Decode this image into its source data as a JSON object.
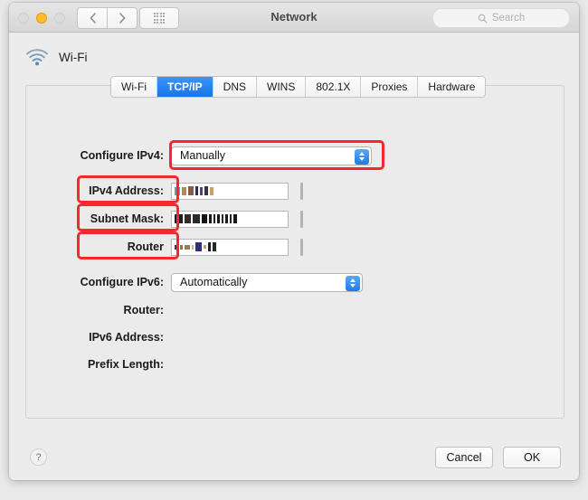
{
  "window": {
    "title": "Network",
    "traffic_lights": [
      "close-button",
      "minimize-button",
      "zoom-button"
    ],
    "nav_back": "‹",
    "nav_forward": "›",
    "grid_button": "show-all-button"
  },
  "search": {
    "placeholder": "Search",
    "icon": "search-icon"
  },
  "service": {
    "name": "Wi-Fi",
    "icon": "wifi-icon"
  },
  "tabs": [
    {
      "label": "Wi-Fi",
      "active": false
    },
    {
      "label": "TCP/IP",
      "active": true
    },
    {
      "label": "DNS",
      "active": false
    },
    {
      "label": "WINS",
      "active": false
    },
    {
      "label": "802.1X",
      "active": false
    },
    {
      "label": "Proxies",
      "active": false
    },
    {
      "label": "Hardware",
      "active": false
    }
  ],
  "form": {
    "configure_ipv4": {
      "label": "Configure IPv4:",
      "value": "Manually",
      "annotated": true
    },
    "ipv4_address": {
      "label": "IPv4 Address:",
      "value": "",
      "redacted": true,
      "annotated": true
    },
    "subnet_mask": {
      "label": "Subnet Mask:",
      "value": "",
      "redacted": true,
      "annotated": true
    },
    "router_v4": {
      "label": "Router",
      "value": "",
      "redacted": true,
      "annotated": true
    },
    "configure_ipv6": {
      "label": "Configure IPv6:",
      "value": "Automatically",
      "annotated": false
    },
    "router_v6": {
      "label": "Router:",
      "value": ""
    },
    "ipv6_address": {
      "label": "IPv6 Address:",
      "value": ""
    },
    "prefix_length": {
      "label": "Prefix Length:",
      "value": ""
    }
  },
  "footer": {
    "help_label": "?",
    "cancel_label": "Cancel",
    "ok_label": "OK"
  },
  "colors": {
    "accent_blue": "#1a74e8",
    "annotation_red": "#f4282d",
    "window_bg": "#ececec",
    "title_text": "#4a4a4a"
  }
}
